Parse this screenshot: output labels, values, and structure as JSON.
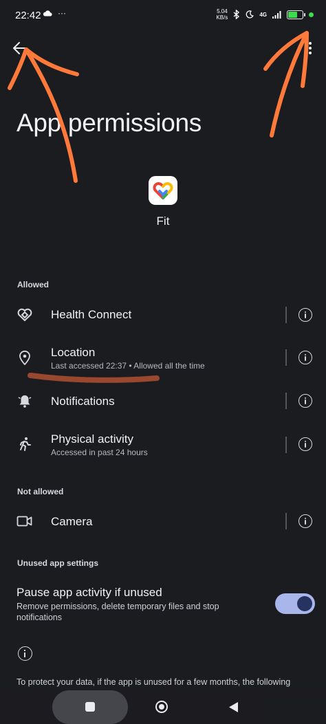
{
  "status_bar": {
    "time": "22:42",
    "more": "···",
    "speed_value": "5.04",
    "speed_unit": "KB/s",
    "network": "4G"
  },
  "header": {
    "title": "App permissions"
  },
  "app": {
    "name": "Fit"
  },
  "sections": {
    "allowed": "Allowed",
    "not_allowed": "Not allowed",
    "unused": "Unused app settings"
  },
  "permissions": {
    "health_connect": {
      "title": "Health Connect",
      "subtitle": ""
    },
    "location": {
      "title": "Location",
      "subtitle": "Last accessed 22:37  •  Allowed all the time"
    },
    "notifications": {
      "title": "Notifications",
      "subtitle": ""
    },
    "physical_activity": {
      "title": "Physical activity",
      "subtitle": "Accessed in past 24 hours"
    },
    "camera": {
      "title": "Camera",
      "subtitle": ""
    }
  },
  "unused_settings": {
    "pause_title": "Pause app activity if unused",
    "pause_desc": "Remove permissions, delete temporary files and stop notifications",
    "toggle_on": true
  },
  "footer": {
    "protect_text": "To protect your data, if the app is unused for a few months, the following"
  },
  "colors": {
    "background": "#1b1c20",
    "toggle_track": "#a9b6ec",
    "toggle_knob": "#26325f",
    "annotation_arrow": "#ff7a3a",
    "redaction_mark": "#a04a30"
  }
}
